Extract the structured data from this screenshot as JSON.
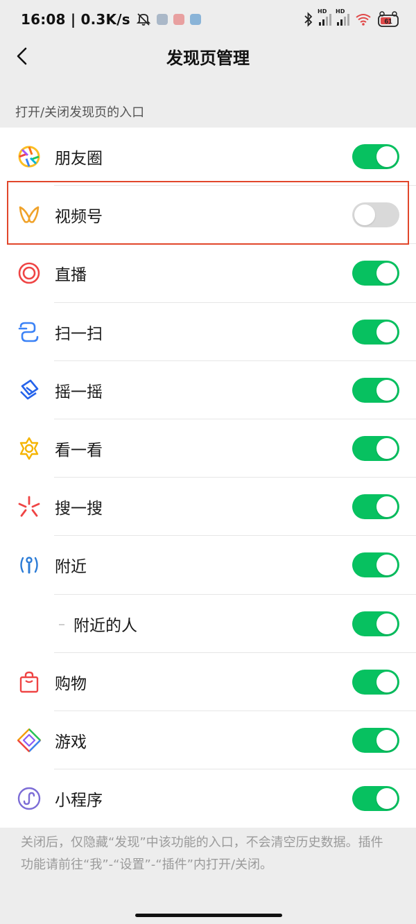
{
  "status_bar": {
    "time_speed": "16:08 | 0.3K/s",
    "battery": "61",
    "network_badge": "HD",
    "icons": [
      "mute-icon",
      "mini-app-icon",
      "mini-app-icon",
      "mini-app-icon",
      "bluetooth-icon",
      "signal-icon",
      "signal-icon",
      "wifi-icon",
      "battery-icon"
    ]
  },
  "header": {
    "title": "发现页管理",
    "back_icon": "chevron-left-icon"
  },
  "section_label": "打开/关闭发现页的入口",
  "items": [
    {
      "label": "朋友圈",
      "icon": "moments-icon",
      "enabled": true
    },
    {
      "label": "视频号",
      "icon": "channels-icon",
      "enabled": false
    },
    {
      "label": "直播",
      "icon": "live-icon",
      "enabled": true
    },
    {
      "label": "扫一扫",
      "icon": "scan-icon",
      "enabled": true
    },
    {
      "label": "摇一摇",
      "icon": "shake-icon",
      "enabled": true
    },
    {
      "label": "看一看",
      "icon": "top-stories-icon",
      "enabled": true
    },
    {
      "label": "搜一搜",
      "icon": "search-icon",
      "enabled": true
    },
    {
      "label": "附近",
      "icon": "nearby-icon",
      "enabled": true
    },
    {
      "label": "附近的人",
      "icon": "",
      "enabled": true,
      "sub": true
    },
    {
      "label": "购物",
      "icon": "shopping-icon",
      "enabled": true
    },
    {
      "label": "游戏",
      "icon": "games-icon",
      "enabled": true
    },
    {
      "label": "小程序",
      "icon": "mini-programs-icon",
      "enabled": true
    }
  ],
  "footer_note": "关闭后，仅隐藏“发现”中该功能的入口，不会清空历史数据。插件功能请前往“我”-“设置”-“插件”内打开/关闭。",
  "colors": {
    "toggle_on": "#07c160",
    "toggle_off": "#d9d9d9",
    "highlight": "#e1462a",
    "background": "#ededed"
  }
}
